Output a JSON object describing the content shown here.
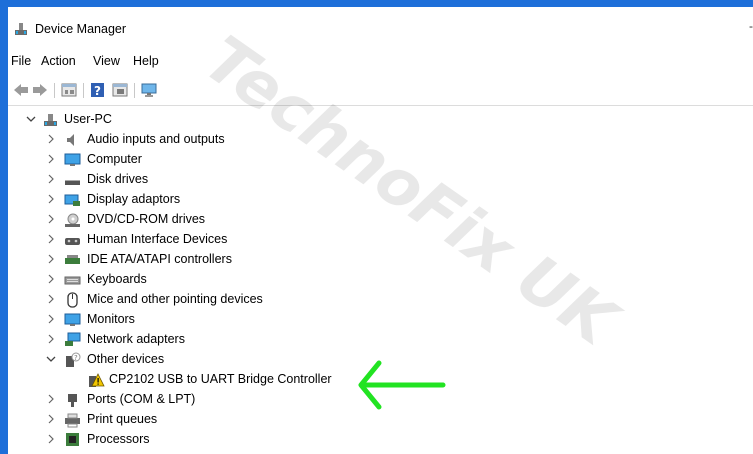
{
  "window": {
    "title": "Device Manager",
    "minimize_glyph": "-"
  },
  "menu": [
    "File",
    "Action",
    "View",
    "Help"
  ],
  "toolbar": {
    "icons": [
      "back-arrow-icon",
      "forward-arrow-icon",
      "properties-icon",
      "help-icon",
      "show-hide-icon",
      "monitor-icon"
    ]
  },
  "tree": {
    "root": "User-PC",
    "items": [
      {
        "label": "Audio inputs and outputs",
        "icon": "speaker-icon"
      },
      {
        "label": "Computer",
        "icon": "computer-icon"
      },
      {
        "label": "Disk drives",
        "icon": "disk-drive-icon"
      },
      {
        "label": "Display adaptors",
        "icon": "display-adapter-icon"
      },
      {
        "label": "DVD/CD-ROM drives",
        "icon": "dvd-drive-icon"
      },
      {
        "label": "Human Interface Devices",
        "icon": "hid-icon"
      },
      {
        "label": "IDE ATA/ATAPI controllers",
        "icon": "ide-controller-icon"
      },
      {
        "label": "Keyboards",
        "icon": "keyboard-icon"
      },
      {
        "label": "Mice and other pointing devices",
        "icon": "mouse-icon"
      },
      {
        "label": "Monitors",
        "icon": "monitor-icon"
      },
      {
        "label": "Network adapters",
        "icon": "network-adapter-icon"
      },
      {
        "label": "Other devices",
        "icon": "unknown-device-icon"
      },
      {
        "label": "CP2102 USB to UART Bridge Controller",
        "icon": "warning-device-icon"
      },
      {
        "label": "Ports (COM & LPT)",
        "icon": "port-icon"
      },
      {
        "label": "Print queues",
        "icon": "printer-icon"
      },
      {
        "label": "Processors",
        "icon": "processor-icon"
      }
    ]
  },
  "watermark": "TechnoFix UK",
  "colors": {
    "accent": "#1e6fd9",
    "arrow": "#22e322"
  }
}
